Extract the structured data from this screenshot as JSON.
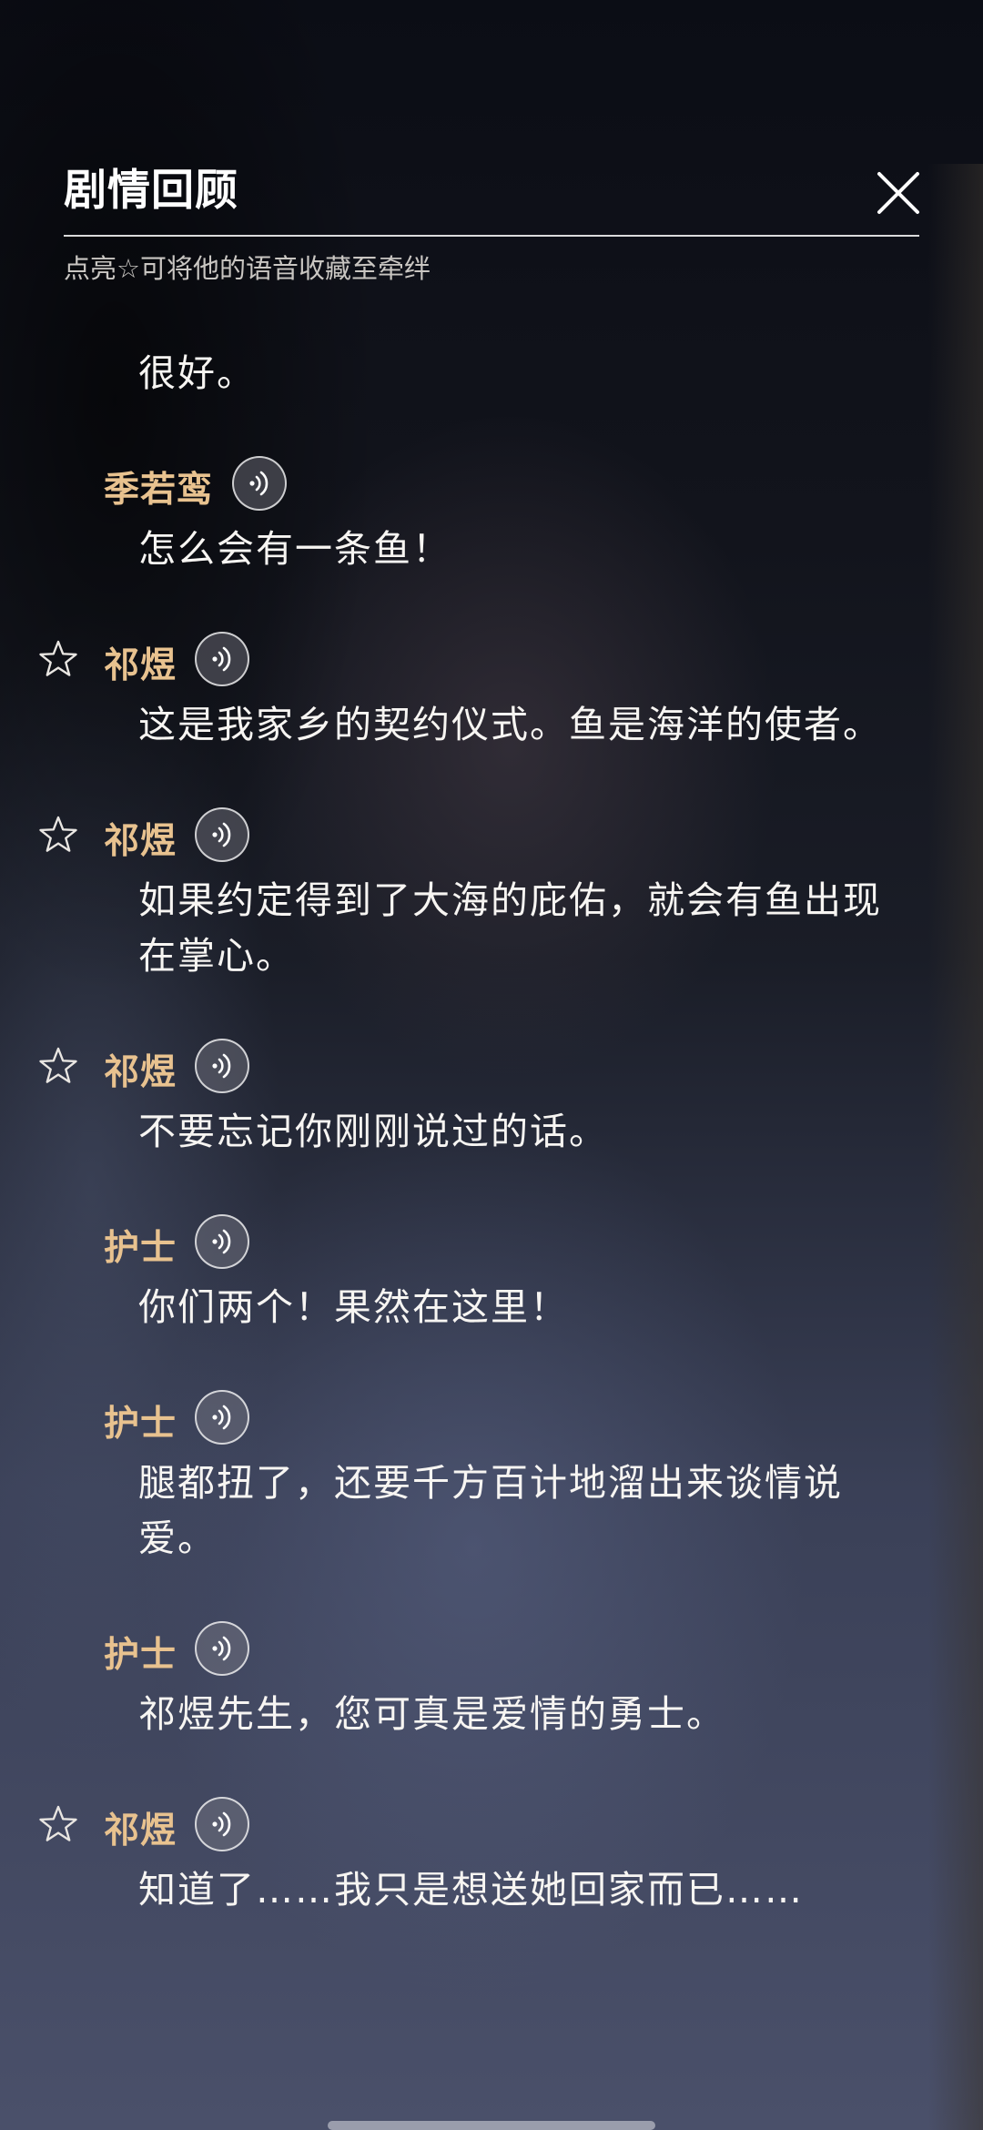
{
  "header": {
    "title": "剧情回顾",
    "subtitle": "点亮☆可将他的语音收藏至牵绊"
  },
  "first_line": "很好。",
  "entries": [
    {
      "speaker": "季若鸾",
      "starred_visible": false,
      "text": "怎么会有一条鱼！"
    },
    {
      "speaker": "祁煜",
      "starred_visible": true,
      "text": "这是我家乡的契约仪式。鱼是海洋的使者。"
    },
    {
      "speaker": "祁煜",
      "starred_visible": true,
      "text": "如果约定得到了大海的庇佑，就会有鱼出现在掌心。"
    },
    {
      "speaker": "祁煜",
      "starred_visible": true,
      "text": "不要忘记你刚刚说过的话。"
    },
    {
      "speaker": "护士",
      "starred_visible": false,
      "text": "你们两个！果然在这里！"
    },
    {
      "speaker": "护士",
      "starred_visible": false,
      "text": "腿都扭了，还要千方百计地溜出来谈情说爱。"
    },
    {
      "speaker": "护士",
      "starred_visible": false,
      "text": "祁煜先生，您可真是爱情的勇士。"
    },
    {
      "speaker": "祁煜",
      "starred_visible": true,
      "text": "知道了……我只是想送她回家而已……"
    }
  ],
  "icons": {
    "close": "close-icon",
    "star": "star-outline-icon",
    "voice": "voice-play-icon"
  },
  "colors": {
    "speaker": "#e8c28f",
    "text": "#f7f5f2",
    "subtitle": "#c9c6c2"
  }
}
